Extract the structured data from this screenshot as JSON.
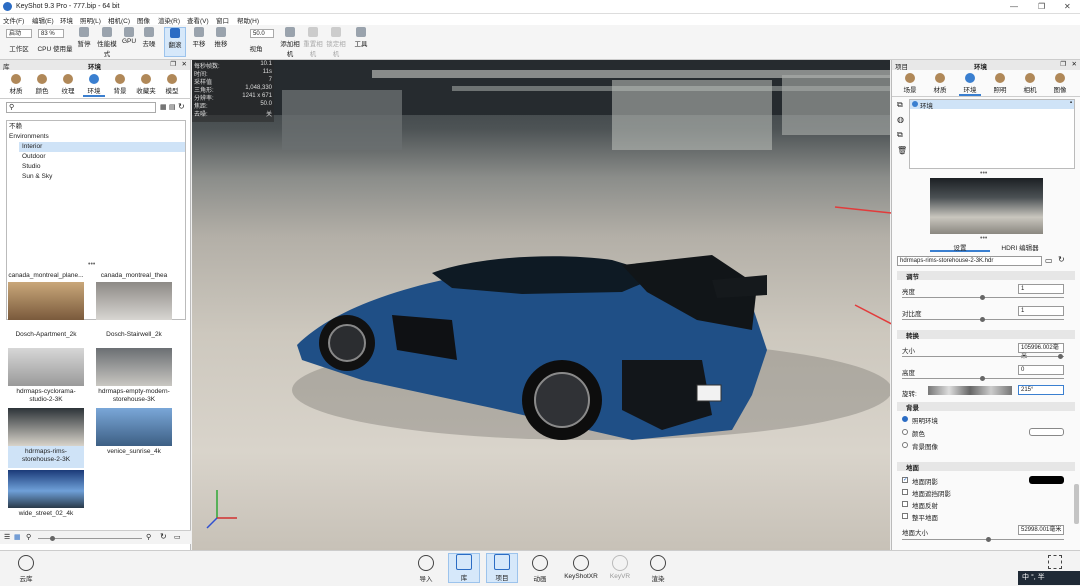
{
  "titlebar": {
    "title": "KeyShot 9.3 Pro  - 777.bip  - 64 bit"
  },
  "menu": [
    "文件(F)",
    "编辑(E)",
    "环境",
    "照明(L)",
    "相机(C)",
    "图像",
    "渲染(R)",
    "查看(V)",
    "窗口",
    "帮助(H)"
  ],
  "toolbar": {
    "mode_select": "启动",
    "percent_select": "83 %",
    "fov_value": "50.0",
    "items": [
      "工作区",
      "CPU 使用量",
      "暂停",
      "性能模式",
      "GPU",
      "去噪",
      "翻滚",
      "平移",
      "推移",
      "视角",
      "添加相机",
      "重置相机",
      "锁定相机",
      "工具"
    ]
  },
  "library": {
    "header": "库",
    "panel_title": "环境",
    "tabs": [
      "材质",
      "颜色",
      "纹理",
      "环境",
      "背景",
      "收藏夹",
      "模型"
    ],
    "tree": [
      "不赖",
      "Environments",
      "Interior",
      "Outdoor",
      "Studio",
      "Sun & Sky"
    ],
    "thumbnails": [
      "canada_montreal_plane...",
      "canada_montreal_thea",
      "Dosch-Apartment_2k",
      "Dosch-Stairwell_2k",
      "hdrmaps-cyclorama-studio-2-3K",
      "hdrmaps-empty-modern-storehouse-3K",
      "hdrmaps-rims-storehouse-2-3K",
      "venice_sunrise_4k",
      "wide_street_02_4k"
    ]
  },
  "stats": [
    [
      "每秒帧数:",
      "10.1"
    ],
    [
      "时间:",
      "11s"
    ],
    [
      "采样值",
      "7"
    ],
    [
      "三角形:",
      "1,048,330"
    ],
    [
      "分辨率:",
      "1241 x 671"
    ],
    [
      "焦距:",
      "50.0"
    ],
    [
      "去噪:",
      "关"
    ]
  ],
  "project": {
    "header": "项目",
    "panel_title": "环境",
    "tabs": [
      "场景",
      "材质",
      "环境",
      "照明",
      "相机",
      "图像"
    ],
    "env_item": "环境",
    "subtabs": [
      "设置",
      "HDRI 编辑器"
    ],
    "hdr_file": "hdrmaps-rims-storehouse-2-3K.hdr",
    "sec_adjust": "调节",
    "brightness_label": "亮度",
    "brightness_value": "1",
    "contrast_label": "对比度",
    "contrast_value": "1",
    "sec_transform": "转换",
    "size_label": "大小",
    "size_value": "105996.002毫米",
    "height_label": "高度",
    "height_value": "0",
    "rotation_label": "旋转:",
    "rotation_value": "215°",
    "sec_background": "背景",
    "bg_options": [
      "照明环境",
      "颜色",
      "背景图像"
    ],
    "sec_ground": "地面",
    "ground_options": [
      "地面阴影",
      "地面遮挡阴影",
      "地面反射",
      "整平地面"
    ],
    "ground_size_label": "地面大小",
    "ground_size_value": "52998.001毫米"
  },
  "bottom": {
    "cloud": "云库",
    "buttons": [
      "导入",
      "库",
      "项目",
      "动画",
      "KeyShotXR",
      "KeyVR",
      "渲染"
    ],
    "ime": "中 °, 半"
  },
  "chart_data": null
}
